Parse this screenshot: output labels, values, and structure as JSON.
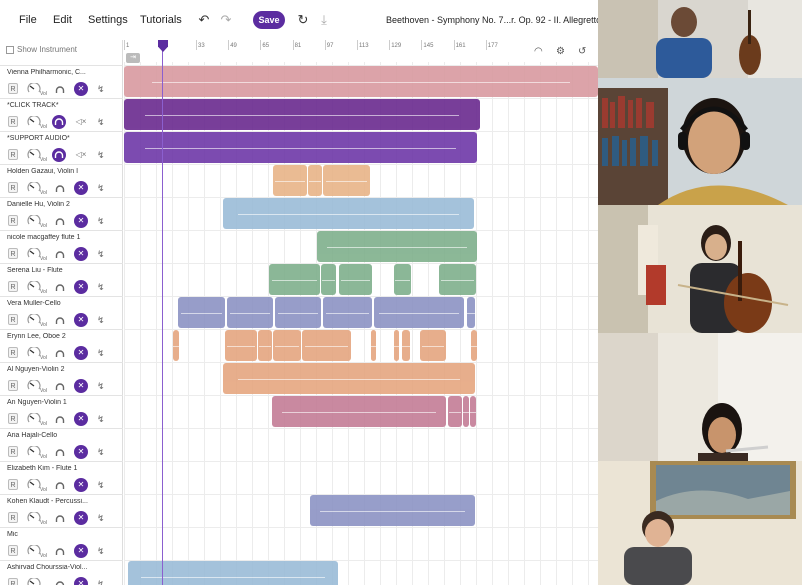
{
  "menu": {
    "file": "File",
    "edit": "Edit",
    "settings": "Settings",
    "tutorials": "Tutorials",
    "save": "Save"
  },
  "project_title": "Beethoven - Symphony No. 7...r. Op. 92 - II. Allegretto",
  "show_instrument": "Show Instrument",
  "ruler_ticks": [
    "1",
    "33",
    "49",
    "65",
    "81",
    "97",
    "113",
    "129",
    "145",
    "161",
    "177"
  ],
  "control_labels": {
    "record": "R",
    "volume": "Vol"
  },
  "tracks": [
    {
      "name": "Vienna Philharmonic, C...",
      "headphone_active": false,
      "muted": true
    },
    {
      "name": "*CLICK TRACK*",
      "headphone_active": true,
      "muted": false
    },
    {
      "name": "*SUPPORT AUDIO*",
      "headphone_active": true,
      "muted": false
    },
    {
      "name": "Holden Gazaui, Violin I",
      "headphone_active": false,
      "muted": true
    },
    {
      "name": "Danielle Hu, Violin 2",
      "headphone_active": false,
      "muted": true
    },
    {
      "name": "nicole macgaffey flute 1",
      "headphone_active": false,
      "muted": true
    },
    {
      "name": "Serena Liu - Flute",
      "headphone_active": false,
      "muted": true
    },
    {
      "name": "Vera Muller-Cello",
      "headphone_active": false,
      "muted": true
    },
    {
      "name": "Erynn Lee, Oboe 2",
      "headphone_active": false,
      "muted": true
    },
    {
      "name": "Al Nguyen-Violin 2",
      "headphone_active": false,
      "muted": true
    },
    {
      "name": "An Nguyen-Violin 1",
      "headphone_active": false,
      "muted": true
    },
    {
      "name": "Aria Hajali-Cello",
      "headphone_active": false,
      "muted": true
    },
    {
      "name": "Elizabeth Kim - Flute 1",
      "headphone_active": false,
      "muted": true
    },
    {
      "name": "Kohen Klaudt - Percussi...",
      "headphone_active": false,
      "muted": true
    },
    {
      "name": "Mic",
      "headphone_active": false,
      "muted": true
    },
    {
      "name": "Ashirvad Chourssia-Viol...",
      "headphone_active": false,
      "muted": true
    }
  ],
  "colors": {
    "accent": "#5b2ca0",
    "clip_pink": "#d99aa0",
    "clip_purple": "#6a2a8f",
    "clip_violet": "#6e38a8",
    "clip_orange": "#e8b488",
    "clip_blue": "#9bbcd8",
    "clip_green": "#7fb08c",
    "clip_slate": "#8c93c4",
    "clip_salmon": "#e5a680",
    "clip_mauve": "#c47d96"
  },
  "participants": [
    "participant-1",
    "participant-2",
    "participant-3",
    "participant-4",
    "participant-5"
  ]
}
